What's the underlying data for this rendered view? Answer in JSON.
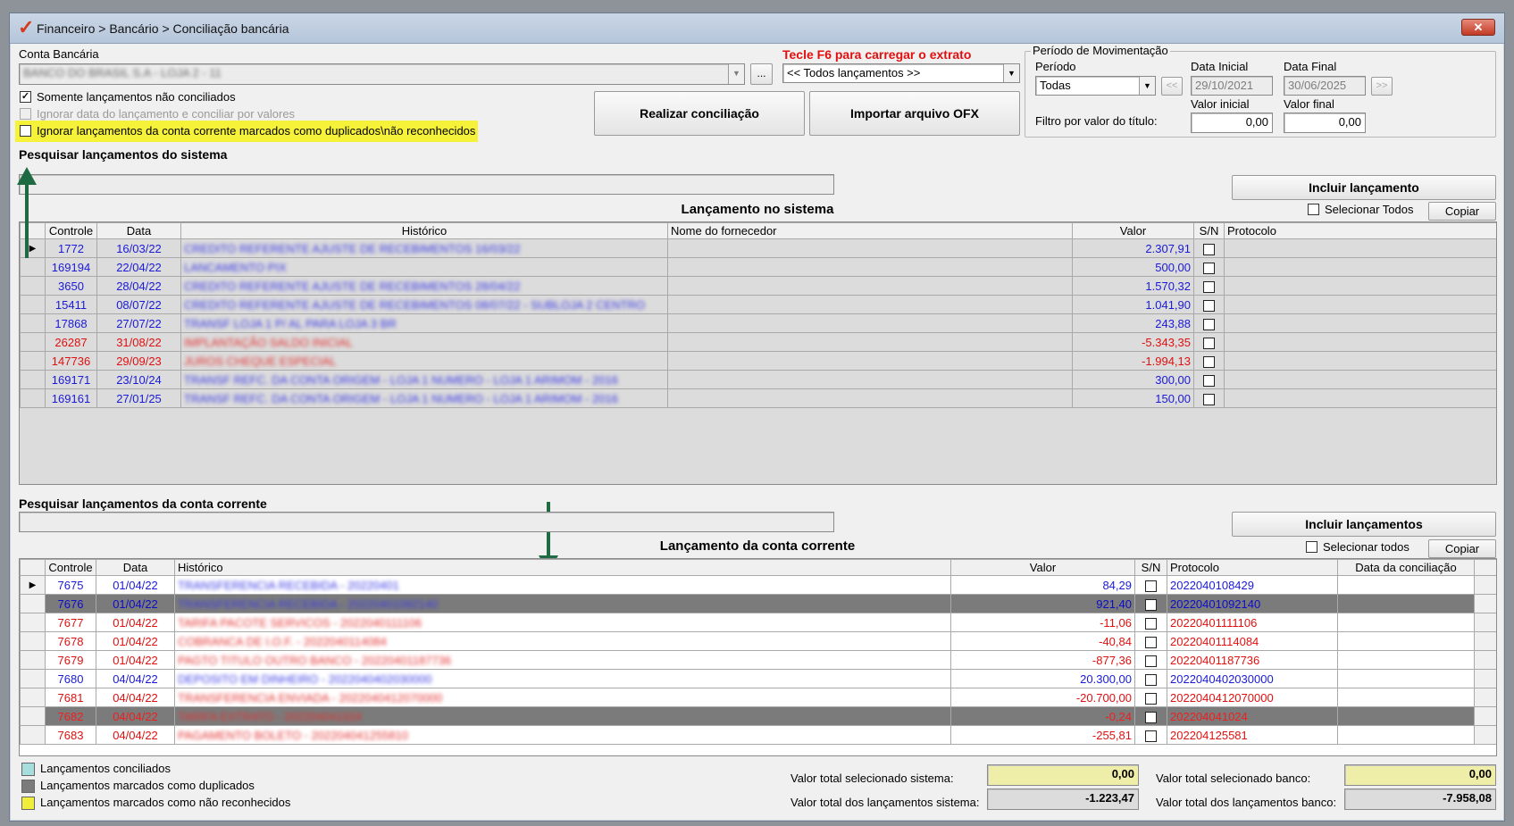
{
  "window": {
    "title": "Financeiro > Bancário > Conciliação bancária",
    "close_label": "✕"
  },
  "conta": {
    "label": "Conta Bancária",
    "value": "BANCO DO BRASIL S.A - LOJA 2 - 11",
    "more_btn": "..."
  },
  "f6": {
    "hint": "Tecle F6 para carregar o extrato",
    "select_value": "<< Todos lançamentos >>"
  },
  "options": {
    "somente": "Somente lançamentos não conciliados",
    "ignorar_data": "Ignorar data do lançamento e conciliar por valores",
    "ignorar_duplicados": "Ignorar lançamentos da conta corrente marcados como duplicados\\não reconhecidos"
  },
  "buttons": {
    "realizar": "Realizar conciliação",
    "importar": "Importar arquivo OFX",
    "incluir_sistema": "Incluir lançamento",
    "incluir_conta": "Incluir lançamentos",
    "copiar": "Copiar"
  },
  "periodo": {
    "group_label": "Período de Movimentação",
    "periodo_label": "Período",
    "periodo_value": "Todas",
    "data_inicial_label": "Data Inicial",
    "data_inicial": "29/10/2021",
    "data_final_label": "Data Final",
    "data_final": "30/06/2025",
    "prev": "<<",
    "next": ">>",
    "filtro_label": "Filtro por valor do título:",
    "valor_inicial_label": "Valor inicial",
    "valor_inicial": "0,00",
    "valor_final_label": "Valor final",
    "valor_final": "0,00"
  },
  "sistema": {
    "search_label": "Pesquisar lançamentos do sistema",
    "title": "Lançamento no sistema",
    "select_all": "Selecionar Todos",
    "columns": [
      "Controle",
      "Data",
      "Histórico",
      "Nome do fornecedor",
      "Valor",
      "S/N",
      "Protocolo"
    ],
    "rows": [
      {
        "controle": "1772",
        "data": "16/03/22",
        "historico": "CREDITO REFERENTE AJUSTE DE RECEBIMENTOS 16/03/22",
        "valor": "2.307,91",
        "color": "blue"
      },
      {
        "controle": "169194",
        "data": "22/04/22",
        "historico": "LANCAMENTO PIX",
        "valor": "500,00",
        "color": "blue"
      },
      {
        "controle": "3650",
        "data": "28/04/22",
        "historico": "CREDITO REFERENTE AJUSTE DE RECEBIMENTOS 28/04/22",
        "valor": "1.570,32",
        "color": "blue"
      },
      {
        "controle": "15411",
        "data": "08/07/22",
        "historico": "CREDITO REFERENTE AJUSTE DE RECEBIMENTOS 08/07/22 - SUBLOJA 2 CENTRO",
        "valor": "1.041,90",
        "color": "blue"
      },
      {
        "controle": "17868",
        "data": "27/07/22",
        "historico": "TRANSF LOJA 1 P/ AL PARA LOJA 3 BR",
        "valor": "243,88",
        "color": "blue"
      },
      {
        "controle": "26287",
        "data": "31/08/22",
        "historico": "IMPLANTAÇÃO SALDO INICIAL",
        "valor": "-5.343,35",
        "color": "red"
      },
      {
        "controle": "147736",
        "data": "29/09/23",
        "historico": "JUROS CHEQUE ESPECIAL",
        "valor": "-1.994,13",
        "color": "red"
      },
      {
        "controle": "169171",
        "data": "23/10/24",
        "historico": "TRANSF REFC. DA CONTA ORIGEM - LOJA 1 NUMERO - LOJA 1 ARIMOM - 2016",
        "valor": "300,00",
        "color": "blue"
      },
      {
        "controle": "169161",
        "data": "27/01/25",
        "historico": "TRANSF REFC. DA CONTA ORIGEM - LOJA 1 NUMERO - LOJA 1 ARIMOM - 2016",
        "valor": "150,00",
        "color": "blue"
      }
    ]
  },
  "conta_corrente": {
    "search_label": "Pesquisar lançamentos da conta corrente",
    "title": "Lançamento da conta corrente",
    "select_all": "Selecionar todos",
    "columns": [
      "Controle",
      "Data",
      "Histórico",
      "Valor",
      "S/N",
      "Protocolo",
      "Data da conciliação"
    ],
    "rows": [
      {
        "controle": "7675",
        "data": "01/04/22",
        "historico": "TRANSFERENCIA RECEBIDA - 20220401",
        "valor": "84,29",
        "protocolo": "2022040108429",
        "color": "blue",
        "dark": false
      },
      {
        "controle": "7676",
        "data": "01/04/22",
        "historico": "TRANSFERENCIA RECEBIDA - 20220401092140",
        "valor": "921,40",
        "protocolo": "20220401092140",
        "color": "blue",
        "dark": true
      },
      {
        "controle": "7677",
        "data": "01/04/22",
        "historico": "TARIFA PACOTE SERVICOS - 2022040111106",
        "valor": "-11,06",
        "protocolo": "20220401111106",
        "color": "red",
        "dark": false
      },
      {
        "controle": "7678",
        "data": "01/04/22",
        "historico": "COBRANCA DE I.O.F. - 2022040114084",
        "valor": "-40,84",
        "protocolo": "20220401114084",
        "color": "red",
        "dark": false
      },
      {
        "controle": "7679",
        "data": "01/04/22",
        "historico": "PAGTO TITULO OUTRO BANCO - 20220401187736",
        "valor": "-877,36",
        "protocolo": "20220401187736",
        "color": "red",
        "dark": false
      },
      {
        "controle": "7680",
        "data": "04/04/22",
        "historico": "DEPOSITO EM DINHEIRO - 2022040402030000",
        "valor": "20.300,00",
        "protocolo": "2022040402030000",
        "color": "blue",
        "dark": false
      },
      {
        "controle": "7681",
        "data": "04/04/22",
        "historico": "TRANSFERENCIA ENVIADA - 2022040412070000",
        "valor": "-20.700,00",
        "protocolo": "2022040412070000",
        "color": "red",
        "dark": false
      },
      {
        "controle": "7682",
        "data": "04/04/22",
        "historico": "TARIFA EXTRATO - 202204041024",
        "valor": "-0,24",
        "protocolo": "202204041024",
        "color": "red",
        "dark": true
      },
      {
        "controle": "7683",
        "data": "04/04/22",
        "historico": "PAGAMENTO BOLETO - 202204041255810",
        "valor": "-255,81",
        "protocolo": "202204125581",
        "color": "red",
        "dark": false
      }
    ]
  },
  "legend": {
    "conciliados": "Lançamentos conciliados",
    "duplicados": "Lançamentos marcados como duplicados",
    "nao_reconhecidos": "Lançamentos marcados como não reconhecidos",
    "colors": {
      "conciliados": "#a6dede",
      "duplicados": "#7b7b7b",
      "nao_reconhecidos": "#f0ee3a"
    }
  },
  "totals": {
    "sel_sistema_label": "Valor total selecionado sistema:",
    "sel_sistema": "0,00",
    "total_sistema_label": "Valor total dos lançamentos sistema:",
    "total_sistema": "-1.223,47",
    "sel_banco_label": "Valor total selecionado banco:",
    "sel_banco": "0,00",
    "total_banco_label": "Valor total dos lançamentos banco:",
    "total_banco": "-7.958,08"
  }
}
